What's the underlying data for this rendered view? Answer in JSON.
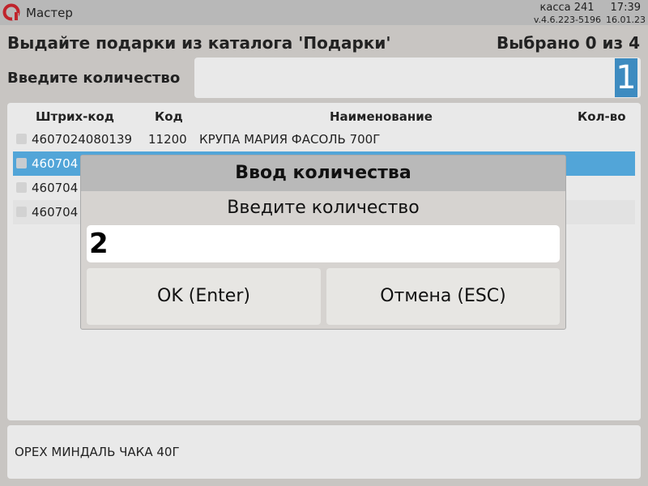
{
  "app": {
    "title": "Мастер",
    "logo_icon": "pos-logo-icon",
    "brand_color": "#c0242c"
  },
  "topbar": {
    "kassa": "касса 241",
    "time": "17:39",
    "version": "v.4.6.223-5196",
    "date": "16.01.23"
  },
  "heading": "Выдайте подарки из каталога 'Подарки'",
  "selected_count": "Выбрано 0 из 4",
  "quantity": {
    "label": "Введите количество",
    "value": "1",
    "accent": "#3d8bc0"
  },
  "table": {
    "headers": {
      "barcode": "Штрих-код",
      "code": "Код",
      "name": "Наименование",
      "qty": "Кол-во"
    },
    "rows": [
      {
        "barcode": "4607024080139",
        "code": "11200",
        "name": "КРУПА МАРИЯ ФАСОЛЬ 700Г",
        "selected": false
      },
      {
        "barcode": "460704",
        "selected": true
      },
      {
        "barcode": "460704",
        "selected": false
      },
      {
        "barcode": "460704",
        "selected": false
      }
    ],
    "selected_row_color": "#52a5d8"
  },
  "dialog": {
    "title": "Ввод количества",
    "prompt": "Введите количество",
    "value": "2",
    "ok_label": "OK (Enter)",
    "cancel_label": "Отмена (ESC)"
  },
  "status": {
    "text": "ОРЕХ МИНДАЛЬ ЧАКА 40Г"
  }
}
